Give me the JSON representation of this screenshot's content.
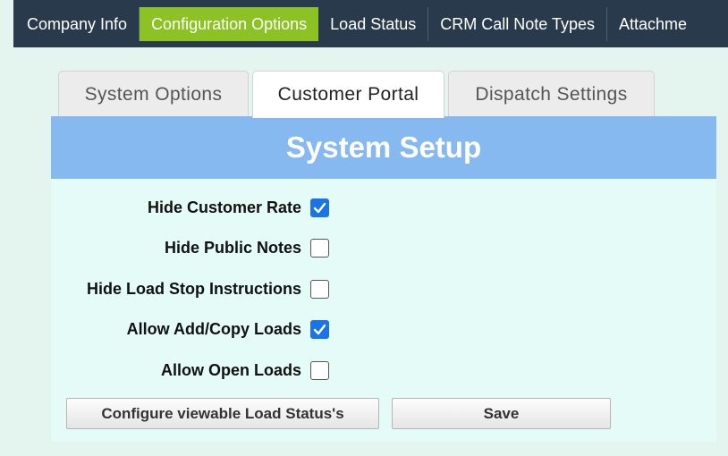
{
  "topnav": {
    "items": [
      {
        "label": "Company Info"
      },
      {
        "label": "Configuration Options"
      },
      {
        "label": "Load Status"
      },
      {
        "label": "CRM Call Note Types"
      },
      {
        "label": "Attachme"
      }
    ],
    "active_label": "Configuration Options"
  },
  "tabs": [
    {
      "label": "System Options"
    },
    {
      "label": "Customer Portal"
    },
    {
      "label": "Dispatch Settings"
    }
  ],
  "active_tab": "Customer Portal",
  "panel": {
    "title": "System Setup",
    "options": [
      {
        "label": "Hide Customer Rate",
        "checked": true
      },
      {
        "label": "Hide Public Notes",
        "checked": false
      },
      {
        "label": "Hide Load Stop Instructions",
        "checked": false
      },
      {
        "label": "Allow Add/Copy Loads",
        "checked": true
      },
      {
        "label": "Allow Open Loads",
        "checked": false
      }
    ],
    "buttons": {
      "configure": "Configure viewable Load Status's",
      "save": "Save"
    }
  },
  "colors": {
    "nav_bg": "#2a3a4d",
    "nav_active": "#8cc223",
    "header_bg": "#87b9f1",
    "panel_bg": "#e4fbf7",
    "checkbox_checked": "#1a73e8"
  }
}
